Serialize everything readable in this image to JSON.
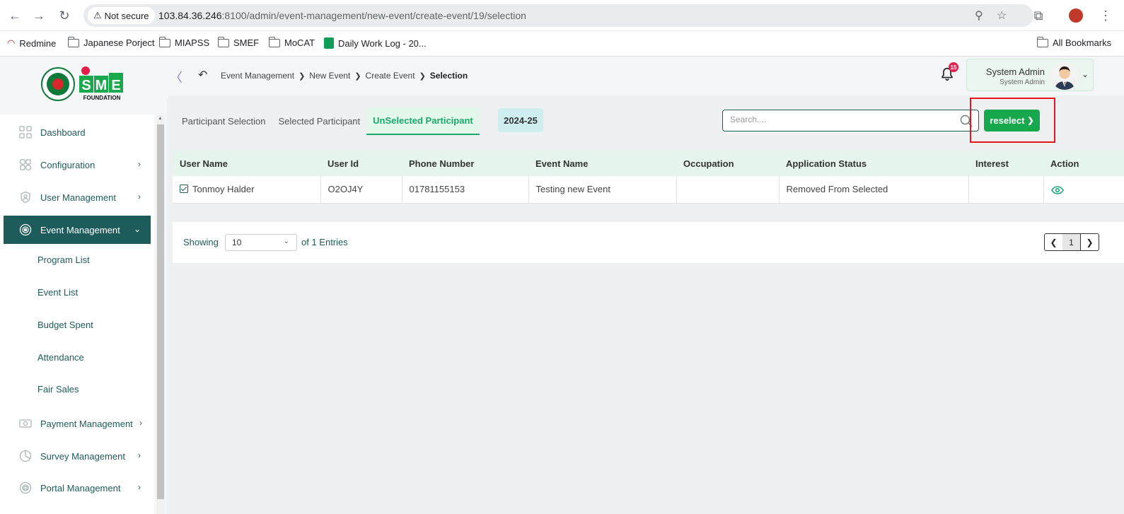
{
  "browser": {
    "security_label": "Not secure",
    "url_host": "103.84.36.246",
    "url_rest": ":8100/admin/event-management/new-event/create-event/19/selection",
    "bookmarks": [
      {
        "label": "Redmine"
      },
      {
        "label": "Japanese Porject"
      },
      {
        "label": "MIAPSS"
      },
      {
        "label": "SMEF"
      },
      {
        "label": "MoCAT"
      },
      {
        "label": "Daily Work Log - 20..."
      }
    ],
    "all_bookmarks": "All Bookmarks"
  },
  "sidebar": {
    "items": [
      {
        "label": "Dashboard",
        "icon": "grid-icon"
      },
      {
        "label": "Configuration",
        "icon": "config-icon"
      },
      {
        "label": "User Management",
        "icon": "shield-icon"
      },
      {
        "label": "Event Management",
        "icon": "event-icon",
        "active": true
      },
      {
        "label": "Payment Management",
        "icon": "money-icon"
      },
      {
        "label": "Survey Management",
        "icon": "pie-icon"
      },
      {
        "label": "Portal Management",
        "icon": "portal-icon"
      }
    ],
    "sub_items": [
      {
        "label": "Program List"
      },
      {
        "label": "Event List"
      },
      {
        "label": "Budget Spent"
      },
      {
        "label": "Attendance"
      },
      {
        "label": "Fair Sales"
      }
    ]
  },
  "header": {
    "breadcrumb": [
      "Event Management",
      "New Event",
      "Create Event",
      "Selection"
    ],
    "notification_count": "15",
    "user_name": "System Admin",
    "user_role": "System Admin"
  },
  "main": {
    "tabs": [
      {
        "label": "Participant Selection"
      },
      {
        "label": "Selected Participant"
      },
      {
        "label": "UnSelected Participant",
        "active": true
      }
    ],
    "year_badge": "2024-25",
    "search_placeholder": "Search....",
    "reselect_label": "reselect",
    "table": {
      "columns": [
        "User Name",
        "User Id",
        "Phone Number",
        "Event Name",
        "Occupation",
        "Application Status",
        "Interest",
        "Action"
      ],
      "rows": [
        {
          "user_name": "Tonmoy Halder",
          "user_id": "O2OJ4Y",
          "phone": "01781155153",
          "event_name": "Testing new Event",
          "occupation": "",
          "status": "Removed From Selected",
          "interest": ""
        }
      ]
    },
    "pagination": {
      "showing_label": "Showing",
      "per_page": "10",
      "entries_label": "of 1 Entries",
      "current_page": "1"
    }
  },
  "colors": {
    "primary": "#1e5b5b",
    "accent_green": "#17a84d",
    "highlight_red": "#e8141c"
  }
}
